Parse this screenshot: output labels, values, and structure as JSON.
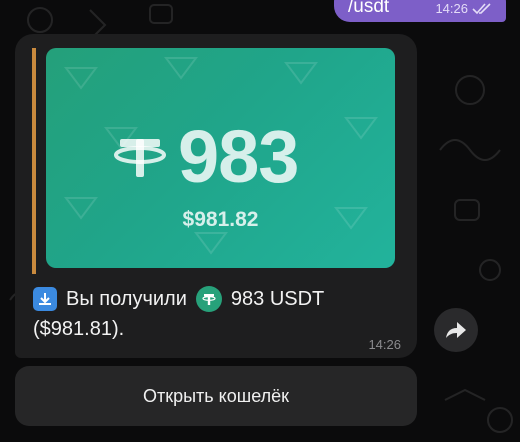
{
  "outgoing": {
    "text": "/usdt",
    "time": "14:26"
  },
  "message": {
    "card": {
      "amount": "983",
      "usd_value": "$981.82",
      "accent": "#24a07a"
    },
    "line1": "Вы получили",
    "line1_amount": "983 USDT",
    "line2": "($981.81).",
    "time": "14:26"
  },
  "keyboard": {
    "button_label": "Открыть кошелёк"
  },
  "icons": {
    "wallet": "wallet-icon",
    "usdt": "tether-icon",
    "forward": "share-arrow-icon"
  }
}
